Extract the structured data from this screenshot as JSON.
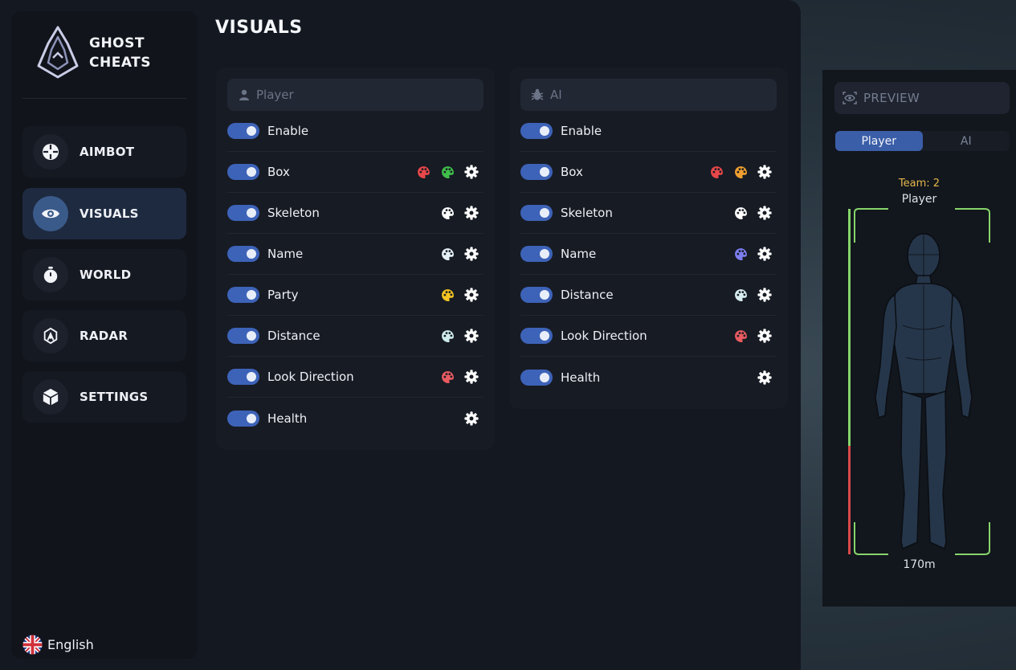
{
  "brand": {
    "line1": "GHOST",
    "line2": "CHEATS"
  },
  "page_title": "VISUALS",
  "nav": [
    {
      "label": "AIMBOT",
      "icon": "crosshair-icon",
      "active": false
    },
    {
      "label": "VISUALS",
      "icon": "eye-icon",
      "active": true
    },
    {
      "label": "WORLD",
      "icon": "stopwatch-icon",
      "active": false
    },
    {
      "label": "RADAR",
      "icon": "radar-icon",
      "active": false
    },
    {
      "label": "SETTINGS",
      "icon": "cube-icon",
      "active": false
    }
  ],
  "language": "English",
  "player_panel": {
    "header": "Player",
    "rows": [
      {
        "label": "Enable",
        "enabled": true,
        "colors": [],
        "settings": false
      },
      {
        "label": "Box",
        "enabled": true,
        "colors": [
          "#e8474a",
          "#3fbf4a"
        ],
        "settings": true
      },
      {
        "label": "Skeleton",
        "enabled": true,
        "colors": [
          "#ffffff"
        ],
        "settings": true
      },
      {
        "label": "Name",
        "enabled": true,
        "colors": [
          "#e4f0f5"
        ],
        "settings": true
      },
      {
        "label": "Party",
        "enabled": true,
        "colors": [
          "#f3c322"
        ],
        "settings": true
      },
      {
        "label": "Distance",
        "enabled": true,
        "colors": [
          "#cdebea"
        ],
        "settings": true
      },
      {
        "label": "Look Direction",
        "enabled": true,
        "colors": [
          "#e85b60"
        ],
        "settings": true
      },
      {
        "label": "Health",
        "enabled": true,
        "colors": [],
        "settings": true
      }
    ]
  },
  "ai_panel": {
    "header": "AI",
    "rows": [
      {
        "label": "Enable",
        "enabled": true,
        "colors": [],
        "settings": false
      },
      {
        "label": "Box",
        "enabled": true,
        "colors": [
          "#e8474a",
          "#f0a030"
        ],
        "settings": true
      },
      {
        "label": "Skeleton",
        "enabled": true,
        "colors": [
          "#ffffff"
        ],
        "settings": true
      },
      {
        "label": "Name",
        "enabled": true,
        "colors": [
          "#7c7ef0"
        ],
        "settings": true
      },
      {
        "label": "Distance",
        "enabled": true,
        "colors": [
          "#d6ecef"
        ],
        "settings": true
      },
      {
        "label": "Look Direction",
        "enabled": true,
        "colors": [
          "#e85b60"
        ],
        "settings": true
      },
      {
        "label": "Health",
        "enabled": true,
        "colors": [],
        "settings": true
      }
    ]
  },
  "preview": {
    "header": "PREVIEW",
    "tabs": [
      {
        "label": "Player",
        "active": true
      },
      {
        "label": "AI",
        "active": false
      }
    ],
    "team": "Team: 2",
    "name": "Player",
    "distance": "170m"
  },
  "colors": {
    "accent": "#3d63b8",
    "box": "#86d46a",
    "health": "#d94a4a",
    "team": "#e5b84a"
  }
}
